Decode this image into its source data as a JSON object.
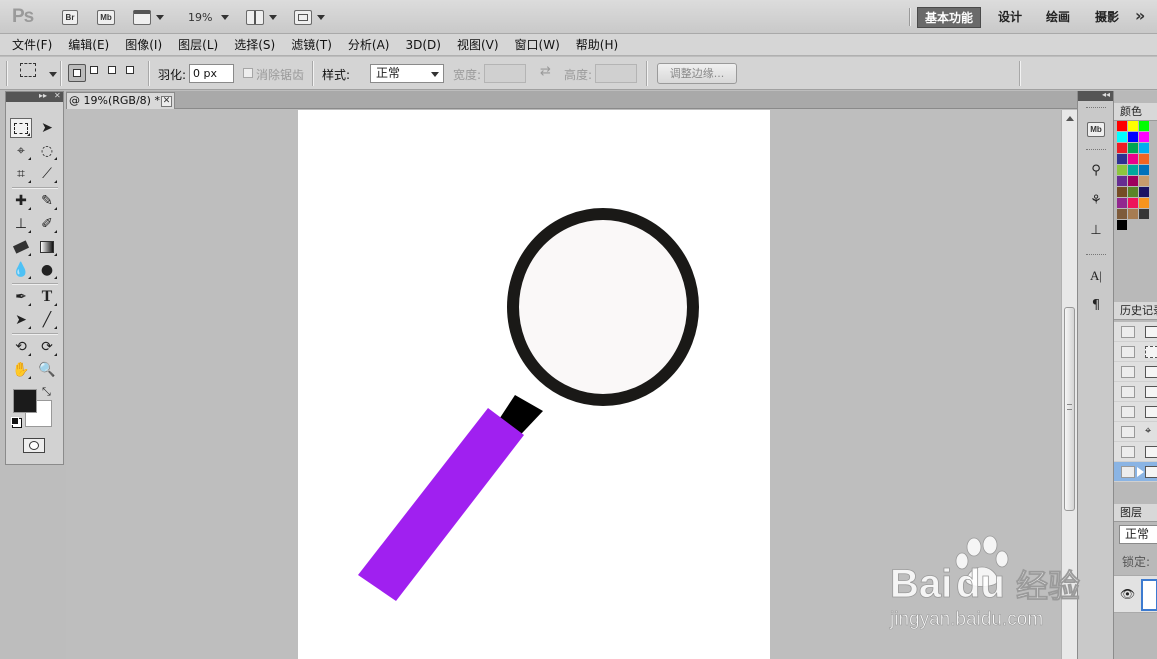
{
  "app": {
    "logo": "Ps"
  },
  "appbar": {
    "bridge_label": "Br",
    "minibridge_label": "Mb",
    "zoom": "19%",
    "workspaces": [
      "基本功能",
      "设计",
      "绘画",
      "摄影"
    ],
    "more": "»"
  },
  "menu": [
    "文件(F)",
    "编辑(E)",
    "图像(I)",
    "图层(L)",
    "选择(S)",
    "滤镜(T)",
    "分析(A)",
    "3D(D)",
    "视图(V)",
    "窗口(W)",
    "帮助(H)"
  ],
  "options": {
    "feather_label": "羽化:",
    "feather_value": "0 px",
    "antialias_label": "消除锯齿",
    "style_label": "样式:",
    "style_value": "正常",
    "width_label": "宽度:",
    "height_label": "高度:",
    "swap_glyph": "⇄",
    "refine_button": "调整边缘..."
  },
  "document": {
    "tab_label": "@ 19%(RGB/8) *",
    "close_glyph": "✕",
    "artwork": {
      "lens_fill": "#faf8f8",
      "ring_color": "#1a1917",
      "neck_color": "#000000",
      "handle_color": "#a020f0"
    }
  },
  "panels": {
    "color_title": "颜色",
    "history_title": "历史记录",
    "layers_title": "图层",
    "blend_mode": "正常",
    "lock_label": "锁定:"
  },
  "watermark": {
    "brand": "Bai",
    "brand_du": "du",
    "brand_cn": "经验",
    "url": "jingyan.baidu.com"
  }
}
